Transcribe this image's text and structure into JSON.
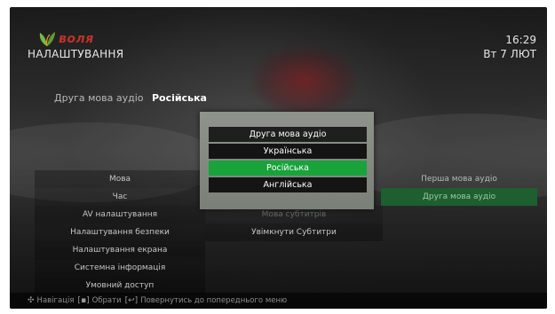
{
  "brand": {
    "name": "воля",
    "colors": {
      "red": "#c0312b",
      "green": "#7ab648"
    }
  },
  "header": {
    "section_title": "НАЛАШТУВАННЯ",
    "time": "16:29",
    "date": "Вт 7 ЛЮТ"
  },
  "current_setting": {
    "label": "Друга мова аудіо",
    "value": "Російська"
  },
  "menu": {
    "items": [
      {
        "label": "Мова"
      },
      {
        "label": "Час"
      },
      {
        "label": "AV налаштування"
      },
      {
        "label": "Налаштування безпеки"
      },
      {
        "label": "Налаштування екрана"
      },
      {
        "label": "Системна інформація"
      },
      {
        "label": "Умовний доступ"
      }
    ]
  },
  "submenu": {
    "items": [
      {
        "label": "Мова субтитрів"
      },
      {
        "label": "Увімкнути Субтитри"
      }
    ]
  },
  "options": {
    "items": [
      {
        "label": "Перша мова аудіо"
      },
      {
        "label": "Друга мова аудіо"
      }
    ],
    "selected_index": 1
  },
  "dialog": {
    "title": "Друга мова аудіо",
    "options": [
      {
        "label": "Українська"
      },
      {
        "label": "Російська"
      },
      {
        "label": "Англійська"
      }
    ],
    "selected_index": 1,
    "accent": "#19a33b"
  },
  "hints": {
    "nav_icon": "dpad-icon",
    "nav_label": "Навігація",
    "ok_icon": "ok-key-icon",
    "ok_label": "Обрати",
    "back_icon": "back-key-icon",
    "back_label": "Повернутись до попереднього меню"
  }
}
